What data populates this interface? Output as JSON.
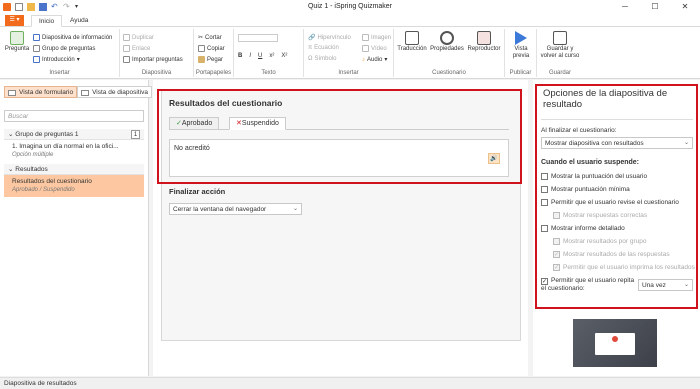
{
  "window": {
    "title": "Quiz 1 - iSpring Quizmaker"
  },
  "tabs": {
    "file": "☰ ▾",
    "inicio": "Inicio",
    "ayuda": "Ayuda"
  },
  "ribbon": {
    "insertar": {
      "label": "Insertar",
      "pregunta": "Pregunta",
      "info": "Diapositiva de información",
      "grupo": "Grupo de preguntas",
      "intro": "Introducción"
    },
    "diapositiva": {
      "label": "Diapositiva",
      "duplicar": "Duplicar",
      "enlace": "Enlace",
      "importar": "Importar preguntas"
    },
    "portapapeles": {
      "label": "Portapapeles",
      "cortar": "Cortar",
      "copiar": "Copiar",
      "pegar": "Pegar"
    },
    "texto": {
      "label": "Texto",
      "b": "B",
      "i": "I",
      "u": "U",
      "x2": "x²",
      "x2b": "X²"
    },
    "insertar2": {
      "label": "Insertar",
      "hiper": "Hipervínculo",
      "ecuacion": "Ecuación",
      "simbolo": "Símbolo",
      "imagen": "Imagen",
      "video": "Vídeo",
      "audio": "Audio"
    },
    "cuestionario": {
      "label": "Cuestionario",
      "traduccion": "Traducción",
      "propiedades": "Propiedades",
      "reproductor": "Reproductor"
    },
    "publicar": {
      "label": "Publicar",
      "vista": "Vista previa"
    },
    "guardar": {
      "label": "Guardar",
      "guardar": "Guardar y volver al curso"
    }
  },
  "left": {
    "tab_form": "Vista de formulario",
    "tab_slide": "Vista de diapositiva",
    "search_placeholder": "Buscar",
    "group1": "Grupo de preguntas 1",
    "group1_count": "1",
    "q1": "1. Imagina un día normal en la ofici...",
    "q1_type": "Opción múltiple",
    "results_head": "Resultados",
    "res_item": "Resultados del cuestionario",
    "res_sub": "Aprobado / Suspendido"
  },
  "center": {
    "title": "Resultados del cuestionario",
    "tab_pass": "Aprobado",
    "tab_fail": "Suspendido",
    "message": "No acreditó",
    "finish_label": "Finalizar acción",
    "finish_value": "Cerrar la ventana del navegador"
  },
  "right": {
    "title": "Opciones de la diapositiva de resultado",
    "on_finish": "Al finalizar el cuestionario:",
    "on_finish_value": "Mostrar diapositiva con resultados",
    "when_fail": "Cuando el usuario suspende:",
    "opt1": "Mostrar la puntuación del usuario",
    "opt2": "Mostrar puntuación mínima",
    "opt3": "Permitir que el usuario revise el cuestionario",
    "opt3a": "Mostrar respuestas correctas",
    "opt4": "Mostrar informe detallado",
    "opt4a": "Mostrar resultados por grupo",
    "opt4b": "Mostrar resultados de las respuestas",
    "opt4c": "Permitir que el usuario imprima los resultados",
    "opt5": "Permitir que el usuario repita el cuestionario:",
    "opt5_value": "Una vez"
  },
  "status": {
    "text": "Diapositiva de resultados"
  },
  "colors": {
    "accent": "#f26b1d",
    "highlight": "#d0121d"
  }
}
